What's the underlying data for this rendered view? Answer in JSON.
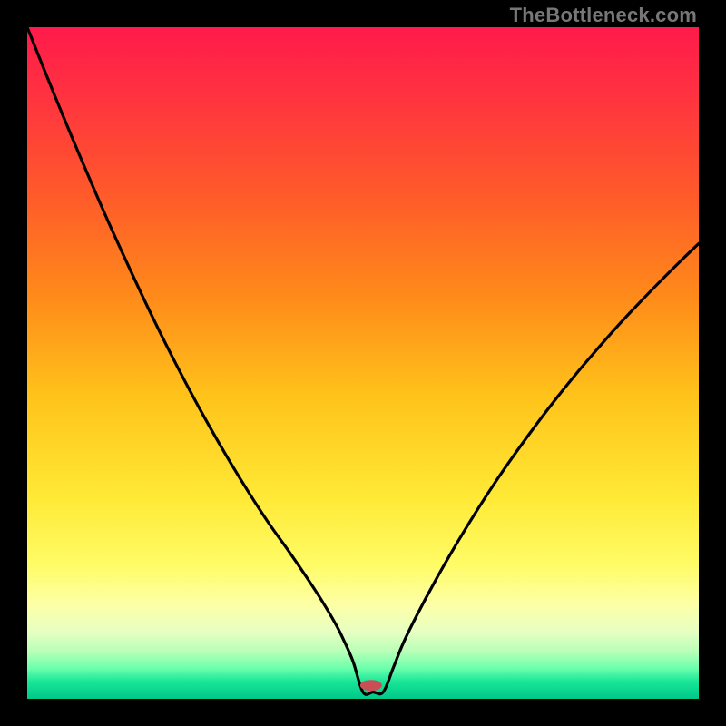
{
  "watermark": "TheBottleneck.com",
  "chart_data": {
    "type": "line",
    "title": "",
    "xlabel": "",
    "ylabel": "",
    "xlim": [
      0,
      100
    ],
    "ylim": [
      0,
      100
    ],
    "series": [
      {
        "name": "curve",
        "x": [
          0,
          3,
          6,
          9,
          12,
          15,
          18,
          21,
          24,
          27,
          30,
          33,
          36,
          39,
          42,
          44,
          46,
          47,
          48.5,
          50,
          51.5,
          53,
          54.5,
          56,
          58,
          61,
          64,
          67,
          70,
          73,
          76,
          79,
          82,
          85,
          88,
          91,
          94,
          97,
          100
        ],
        "y": [
          100,
          92.5,
          85.2,
          78.1,
          71.2,
          64.6,
          58.2,
          52.1,
          46.3,
          40.8,
          35.6,
          30.7,
          26.1,
          21.9,
          17.5,
          14.4,
          11.0,
          9.0,
          5.6,
          1.0,
          1.0,
          1.0,
          4.6,
          8.3,
          12.4,
          18.0,
          23.2,
          28.1,
          32.7,
          37.0,
          41.1,
          45.0,
          48.7,
          52.2,
          55.6,
          58.8,
          61.9,
          64.9,
          67.8
        ]
      }
    ],
    "marker": {
      "x": 51.2,
      "y": 2.0,
      "color": "#c94f55",
      "rx": 12,
      "ry": 6
    },
    "gradient_stops": [
      {
        "offset": 0.0,
        "color": "#ff1a4b"
      },
      {
        "offset": 0.1,
        "color": "#ff3240"
      },
      {
        "offset": 0.25,
        "color": "#ff5a2a"
      },
      {
        "offset": 0.4,
        "color": "#ff8a1a"
      },
      {
        "offset": 0.55,
        "color": "#ffc31a"
      },
      {
        "offset": 0.7,
        "color": "#ffe936"
      },
      {
        "offset": 0.8,
        "color": "#fffc66"
      },
      {
        "offset": 0.86,
        "color": "#fdffa6"
      },
      {
        "offset": 0.9,
        "color": "#e7ffc2"
      },
      {
        "offset": 0.93,
        "color": "#b7ffb8"
      },
      {
        "offset": 0.955,
        "color": "#6affac"
      },
      {
        "offset": 0.975,
        "color": "#17e597"
      },
      {
        "offset": 1.0,
        "color": "#00c888"
      }
    ]
  }
}
